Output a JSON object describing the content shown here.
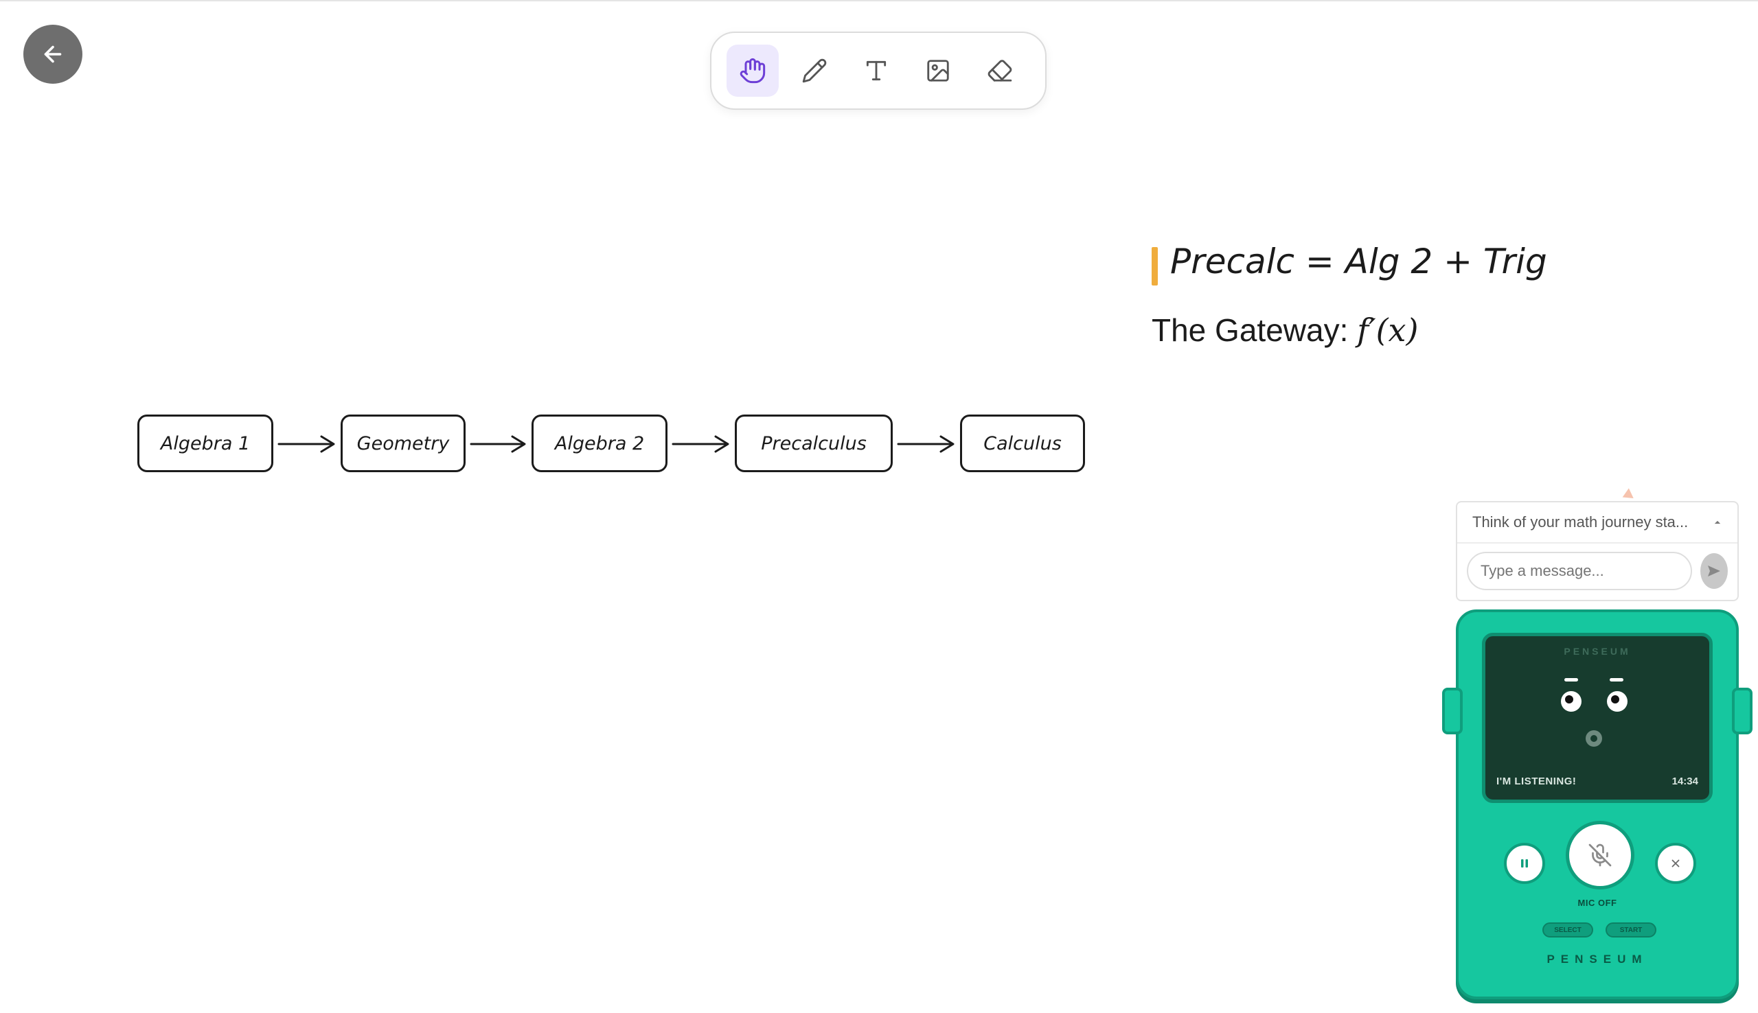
{
  "toolbar": {
    "tools": [
      {
        "icon": "hand-icon",
        "active": true
      },
      {
        "icon": "pencil-icon",
        "active": false
      },
      {
        "icon": "text-icon",
        "active": false
      },
      {
        "icon": "image-icon",
        "active": false
      },
      {
        "icon": "eraser-icon",
        "active": false
      }
    ],
    "accent": "#6d3fd6"
  },
  "flowchart": {
    "nodes": [
      "Algebra 1",
      "Geometry",
      "Algebra 2",
      "Precalculus",
      "Calculus"
    ]
  },
  "note": {
    "title": "Precalc = Alg 2 + Trig",
    "subtitle_text": "The Gateway: ",
    "subtitle_math": "f′(x)",
    "accent": "#f0ad3d"
  },
  "chat": {
    "prompt": "Think of your math journey sta...",
    "input_placeholder": "Type a message..."
  },
  "device": {
    "screen_brand": "PENSEUM",
    "status": "I'M LISTENING!",
    "time": "14:34",
    "mic_label": "MIC OFF",
    "select_label": "SELECT",
    "start_label": "START",
    "brand": "PENSEUM",
    "body_color": "#16c79f"
  }
}
